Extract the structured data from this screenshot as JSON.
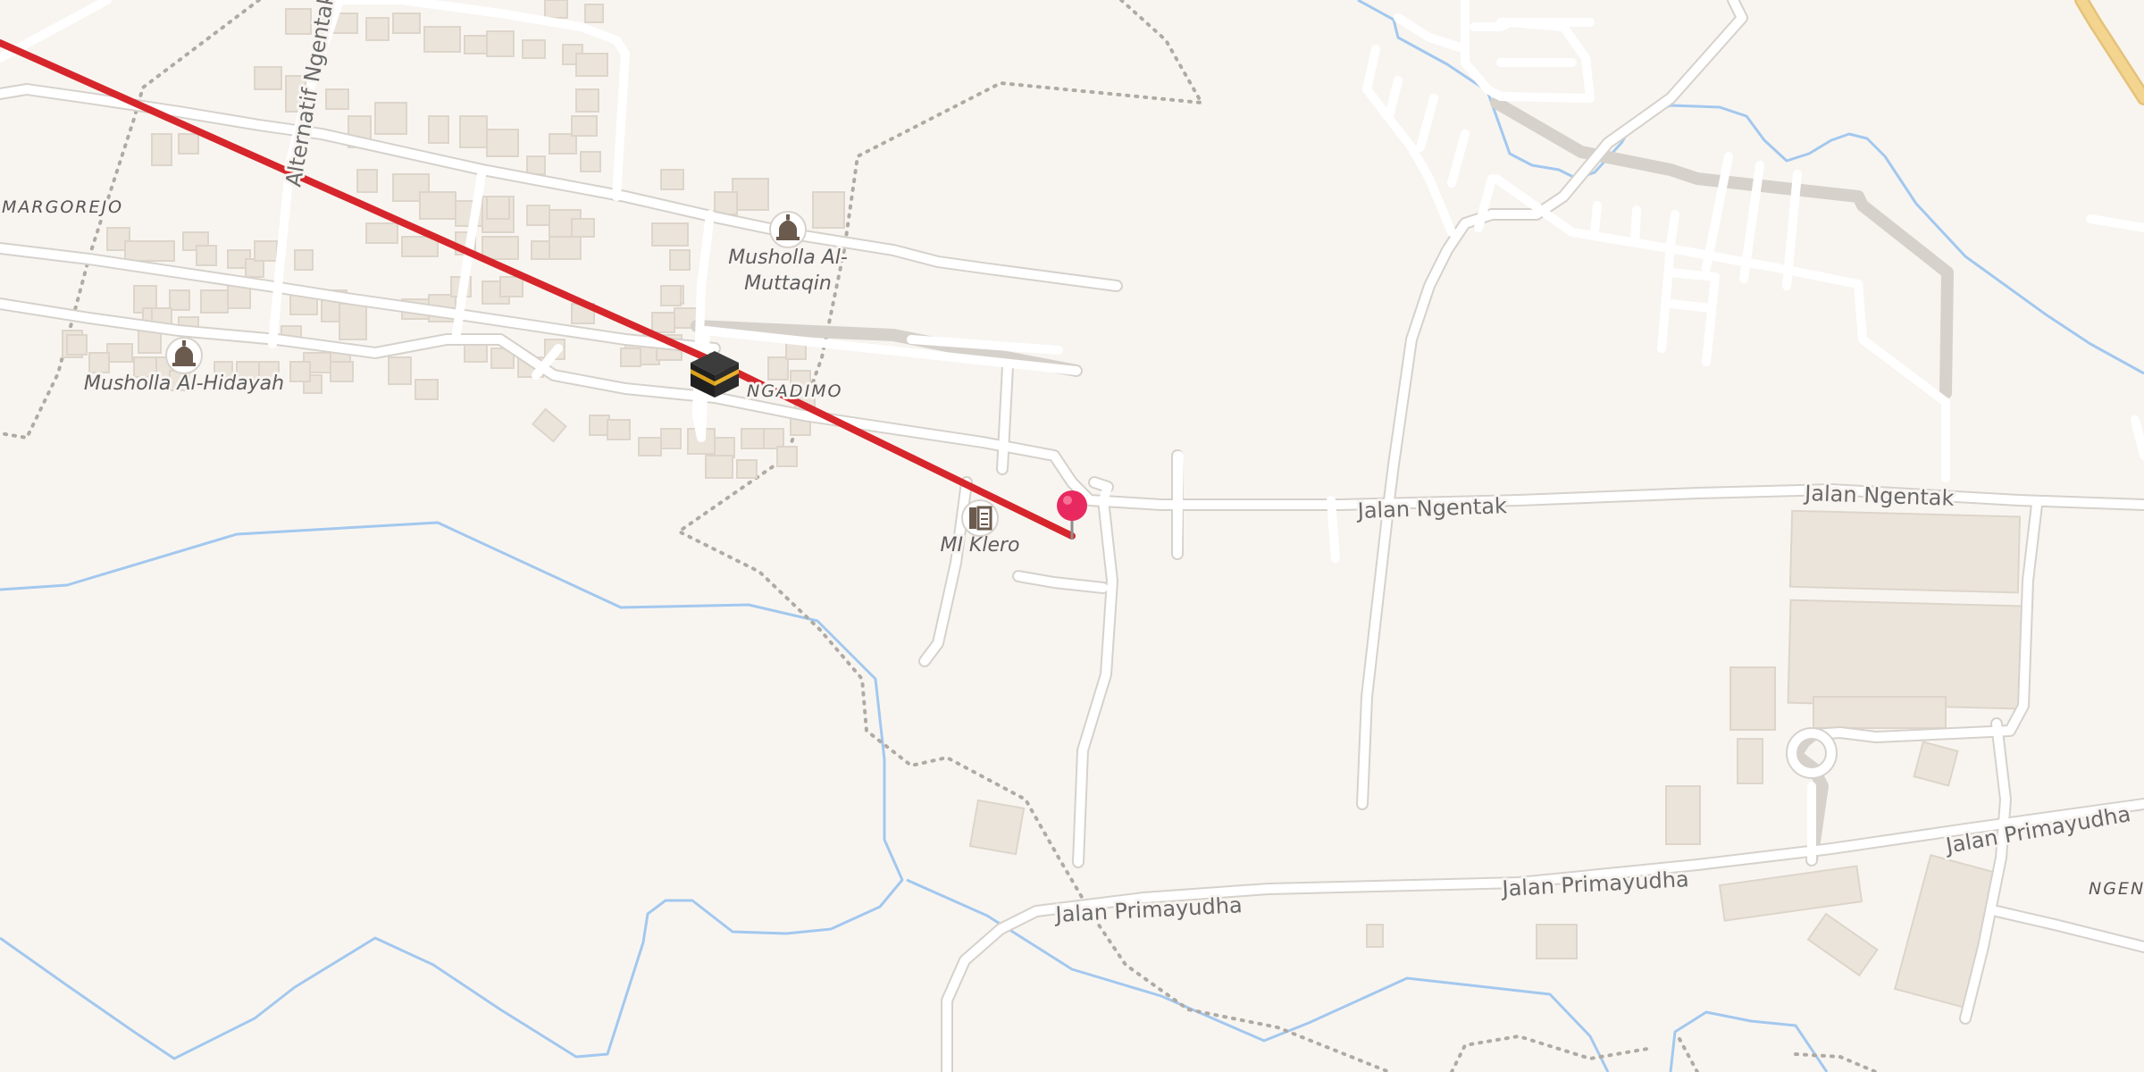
{
  "map": {
    "place_labels": {
      "margorejo": "MARGOREJO",
      "ngadimo": "NGADIMO",
      "ngentak": "NGENTAK"
    },
    "poi_labels": {
      "musholla_hidayah": "Musholla Al-Hidayah",
      "musholla_muttaqin_1": "Musholla Al-",
      "musholla_muttaqin_2": "Muttaqin",
      "mi_klero": "MI Klero"
    },
    "road_labels": {
      "ngentak_alt": "Alternatif Ngentak",
      "ngentak_1": "Jalan Ngentak",
      "ngentak_2": "Jalan Ngentak",
      "primayudha_1": "Jalan Primayudha",
      "primayudha_2": "Jalan Primayudha",
      "primayudha_3": "Jalan Primayudha"
    },
    "icons": [
      "mosque-icon",
      "school-icon",
      "kaaba-icon",
      "location-pin-icon"
    ],
    "colors": {
      "route": "#d6262b",
      "pin": "#e8295f",
      "water": "#a3c8ee",
      "background": "#f8f5f1",
      "major_road": "#f3d58f"
    }
  }
}
